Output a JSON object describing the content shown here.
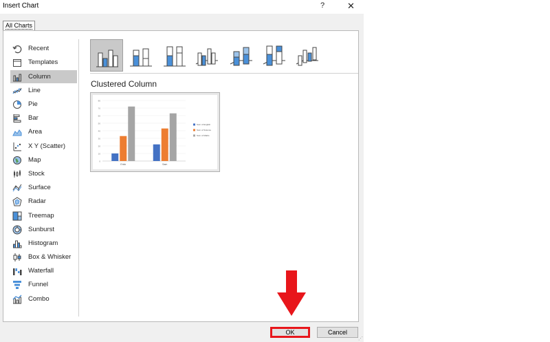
{
  "window": {
    "title": "Insert Chart",
    "help": "?",
    "close": "✕"
  },
  "tabs": [
    {
      "label": "All Charts"
    }
  ],
  "sidebar": {
    "items": [
      {
        "label": "Recent",
        "icon": "recent-icon"
      },
      {
        "label": "Templates",
        "icon": "templates-icon"
      },
      {
        "label": "Column",
        "icon": "column-chart-icon",
        "selected": true
      },
      {
        "label": "Line",
        "icon": "line-chart-icon"
      },
      {
        "label": "Pie",
        "icon": "pie-chart-icon"
      },
      {
        "label": "Bar",
        "icon": "bar-chart-icon"
      },
      {
        "label": "Area",
        "icon": "area-chart-icon"
      },
      {
        "label": "X Y (Scatter)",
        "icon": "scatter-chart-icon"
      },
      {
        "label": "Map",
        "icon": "map-chart-icon"
      },
      {
        "label": "Stock",
        "icon": "stock-chart-icon"
      },
      {
        "label": "Surface",
        "icon": "surface-chart-icon"
      },
      {
        "label": "Radar",
        "icon": "radar-chart-icon"
      },
      {
        "label": "Treemap",
        "icon": "treemap-chart-icon"
      },
      {
        "label": "Sunburst",
        "icon": "sunburst-chart-icon"
      },
      {
        "label": "Histogram",
        "icon": "histogram-chart-icon"
      },
      {
        "label": "Box & Whisker",
        "icon": "box-whisker-chart-icon"
      },
      {
        "label": "Waterfall",
        "icon": "waterfall-chart-icon"
      },
      {
        "label": "Funnel",
        "icon": "funnel-chart-icon"
      },
      {
        "label": "Combo",
        "icon": "combo-chart-icon"
      }
    ]
  },
  "subtypes": [
    {
      "name": "clustered-column",
      "selected": true
    },
    {
      "name": "stacked-column"
    },
    {
      "name": "100-stacked-column"
    },
    {
      "name": "3d-clustered-column"
    },
    {
      "name": "3d-stacked-column"
    },
    {
      "name": "3d-100-stacked-column"
    },
    {
      "name": "3d-column"
    }
  ],
  "preview": {
    "title": "Clustered Column",
    "chart_data": {
      "type": "bar",
      "categories": [
        "Erick",
        "Sam"
      ],
      "series": [
        {
          "name": "Sum of English",
          "values": [
            10,
            22
          ],
          "color": "#4472c4"
        },
        {
          "name": "Sum of Science",
          "values": [
            33,
            43
          ],
          "color": "#ed7d31"
        },
        {
          "name": "Sum of Maths",
          "values": [
            72,
            63
          ],
          "color": "#a5a5a5"
        }
      ],
      "ylim": [
        0,
        80
      ],
      "yticks": [
        "0",
        "10",
        "20",
        "30",
        "40",
        "50",
        "60",
        "70",
        "80"
      ],
      "legend": "right",
      "grid": true
    }
  },
  "buttons": {
    "ok": "OK",
    "cancel": "Cancel"
  },
  "colors": {
    "accent": "#4a90d9",
    "annotation": "#e8161b",
    "selection": "#c9c9c9"
  }
}
